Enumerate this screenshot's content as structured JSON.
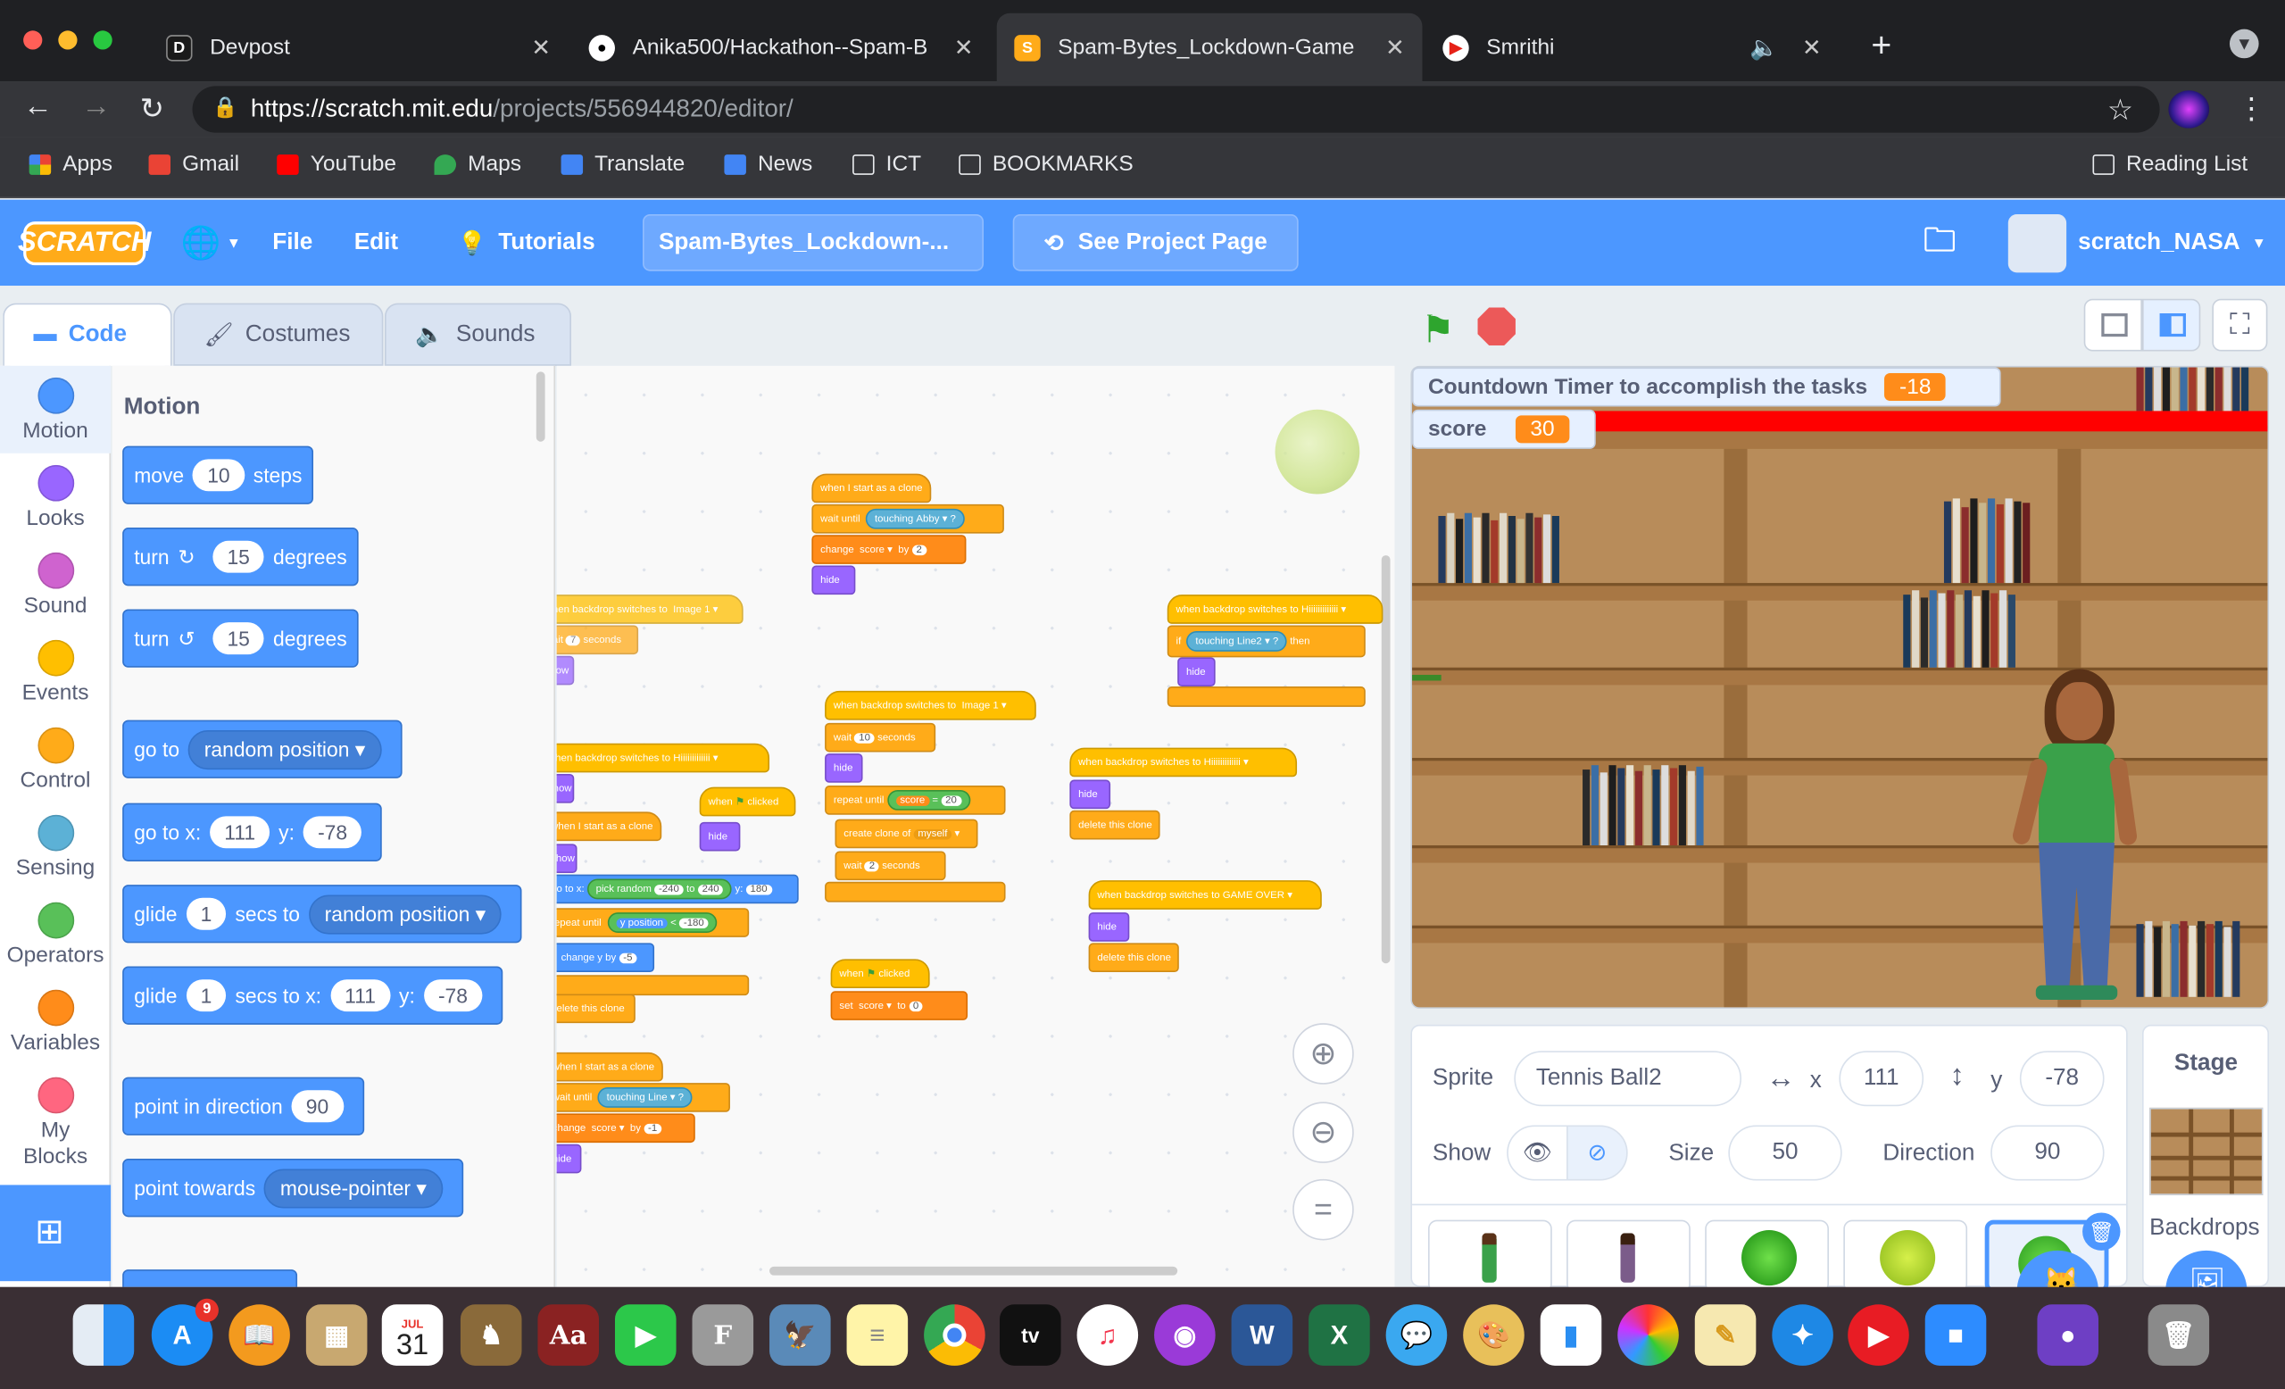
{
  "browser": {
    "tabs": [
      {
        "label": "Devpost",
        "fav": "D"
      },
      {
        "label": "Anika500/Hackathon--Spam-B",
        "fav": "gh"
      },
      {
        "label": "Spam-Bytes_Lockdown-Game",
        "fav": "S"
      },
      {
        "label": "Smrithi",
        "fav": "yt"
      }
    ],
    "new_tab": "+",
    "url_host": "https://scratch.mit.edu",
    "url_path": "/projects/556944820/editor/",
    "bookmarks": [
      "Apps",
      "Gmail",
      "YouTube",
      "Maps",
      "Translate",
      "News",
      "ICT",
      "BOOKMARKS"
    ],
    "reading_list": "Reading List"
  },
  "scratch_menu": {
    "logo": "SCRATCH",
    "file": "File",
    "edit": "Edit",
    "tutorials": "Tutorials",
    "project_title": "Spam-Bytes_Lockdown-...",
    "see_project_page": "See Project Page",
    "username": "scratch_NASA"
  },
  "editor_tabs": [
    "Code",
    "Costumes",
    "Sounds"
  ],
  "categories": [
    {
      "label": "Motion",
      "color": "#4c97ff"
    },
    {
      "label": "Looks",
      "color": "#9966ff"
    },
    {
      "label": "Sound",
      "color": "#cf63cf"
    },
    {
      "label": "Events",
      "color": "#ffbf00"
    },
    {
      "label": "Control",
      "color": "#ffab19"
    },
    {
      "label": "Sensing",
      "color": "#5cb1d6"
    },
    {
      "label": "Operators",
      "color": "#59c059"
    },
    {
      "label": "Variables",
      "color": "#ff8c1a"
    },
    {
      "label": "My Blocks",
      "color": "#ff6680"
    }
  ],
  "palette": {
    "heading": "Motion",
    "move": {
      "a": "move",
      "n": "10",
      "b": "steps"
    },
    "turn_right": {
      "a": "turn",
      "n": "15",
      "b": "degrees"
    },
    "turn_left": {
      "a": "turn",
      "n": "15",
      "b": "degrees"
    },
    "goto": {
      "a": "go to",
      "d": "random position"
    },
    "goto_xy": {
      "a": "go to x:",
      "x": "111",
      "b": "y:",
      "y": "-78"
    },
    "glide": {
      "a": "glide",
      "n": "1",
      "b": "secs to",
      "d": "random position"
    },
    "glide_xy": {
      "a": "glide",
      "n": "1",
      "b": "secs to x:",
      "x": "111",
      "c": "y:",
      "y": "-78"
    },
    "point_dir": {
      "a": "point in direction",
      "n": "90"
    },
    "point_towards": {
      "a": "point towards",
      "d": "mouse-pointer"
    }
  },
  "scripts": {
    "s1": [
      "when I start as a clone",
      "wait until",
      "touching",
      "Abby",
      "?",
      "change",
      "score",
      "by",
      "2",
      "hide"
    ],
    "s2": [
      "when backdrop switches to",
      "Image 1",
      "wait",
      "7",
      "seconds",
      "show"
    ],
    "s3": [
      "when backdrop switches to",
      "Hiiiiiiiiiiiii",
      "if",
      "touching",
      "Line2",
      "?",
      "then",
      "hide"
    ],
    "s4": [
      "when backdrop switches to",
      "Image 1",
      "wait",
      "10",
      "seconds",
      "hide",
      "repeat until",
      "score",
      "=",
      "20",
      "create clone of",
      "myself",
      "wait",
      "2",
      "seconds"
    ],
    "s5": [
      "when backdrop switches to",
      "Hiiiiiiiiiiiii",
      "show",
      "when I start as a clone",
      "show",
      "go to x:",
      "pick random",
      "-240",
      "to",
      "240",
      "y:",
      "180",
      "repeat until",
      "y position",
      "<",
      "-180",
      "change y by",
      "-5",
      "delete this clone"
    ],
    "s6": [
      "when",
      "clicked",
      "hide"
    ],
    "s7": [
      "when backdrop switches to",
      "Hiiiiiiiiiiiii",
      "hide",
      "delete this clone"
    ],
    "s8": [
      "when backdrop switches to",
      "GAME OVER",
      "hide",
      "delete this clone"
    ],
    "s9": [
      "when",
      "clicked",
      "set",
      "score",
      "to",
      "0"
    ],
    "s10": [
      "when I start as a clone",
      "wait until",
      "touching",
      "Line",
      "?",
      "change",
      "score",
      "by",
      "-1",
      "hide"
    ]
  },
  "stage": {
    "monitor_timer_label": "Countdown Timer to accomplish the tasks",
    "monitor_timer_value": "-18",
    "monitor_score_label": "score",
    "monitor_score_value": "30"
  },
  "sprite_info": {
    "sprite_label": "Sprite",
    "sprite_name": "Tennis Ball2",
    "x_label": "x",
    "x": "111",
    "y_label": "y",
    "y": "-78",
    "show_label": "Show",
    "size_label": "Size",
    "size": "50",
    "direction_label": "Direction",
    "direction": "90"
  },
  "stage_panel": {
    "title": "Stage",
    "backdrops": "Backdrops"
  },
  "dock": {
    "calendar_month": "JUL",
    "calendar_day": "31",
    "badge": "9"
  }
}
